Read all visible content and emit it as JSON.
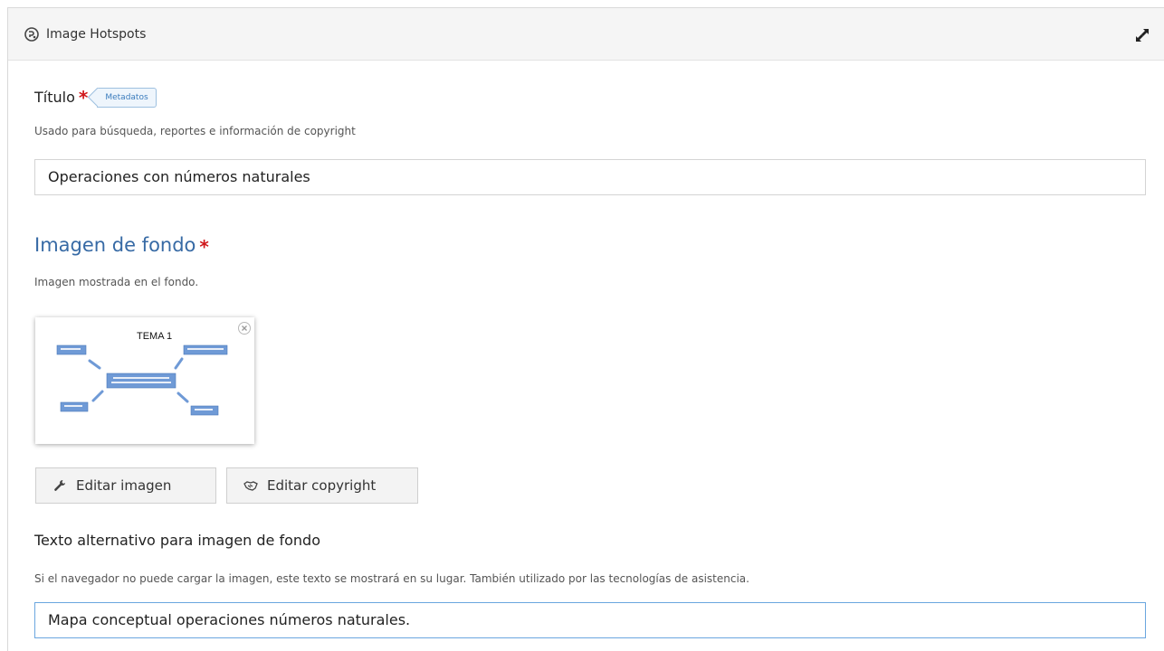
{
  "header": {
    "title": "Image Hotspots",
    "icon": "h5p-logo-icon",
    "expand_icon": "expand-icon"
  },
  "title_field": {
    "label": "Título",
    "required_mark": "*",
    "badge": "Metadatos",
    "description": "Usado para búsqueda, reportes e información de copyright",
    "value": "Operaciones con números naturales"
  },
  "background_image": {
    "section_title": "Imagen de fondo",
    "required_mark": "*",
    "description": "Imagen mostrada en el fondo.",
    "thumbnail": {
      "heading": "TEMA 1"
    },
    "buttons": {
      "edit_image": "Editar imagen",
      "edit_copyright": "Editar copyright"
    }
  },
  "alt_text_field": {
    "label": "Texto alternativo para imagen de fondo",
    "description": "Si el navegador no puede cargar la imagen, este texto se mostrará en su lugar. También utilizado por las tecnologías de asistencia.",
    "value": "Mapa conceptual operaciones números naturales."
  },
  "colors": {
    "accent_blue": "#376aa5",
    "required_red": "#d0171b",
    "focus_border": "#6aa6df"
  }
}
